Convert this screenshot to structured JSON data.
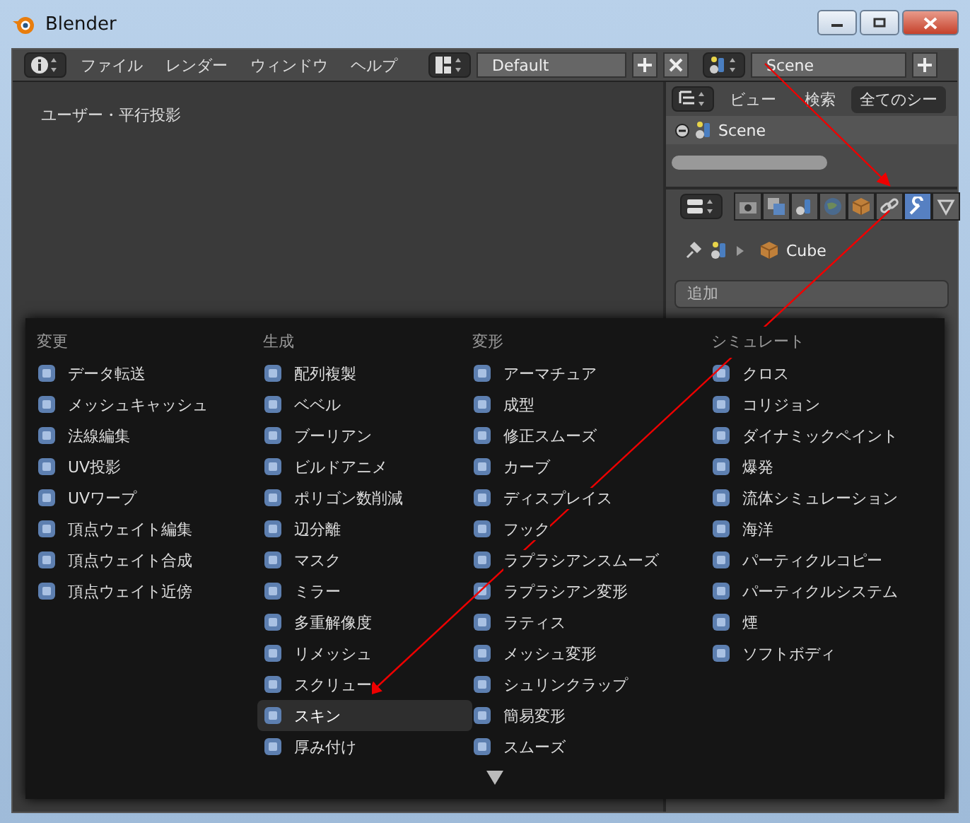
{
  "window": {
    "title": "Blender"
  },
  "top_bar": {
    "menus": [
      "ファイル",
      "レンダー",
      "ウィンドウ",
      "ヘルプ"
    ],
    "layout": "Default",
    "scene": "Scene"
  },
  "viewport": {
    "label": "ユーザー・平行投影"
  },
  "outliner": {
    "menus": [
      "ビュー",
      "検索"
    ],
    "filter": "全てのシー",
    "rows": [
      {
        "label": "Scene",
        "expanded": true
      }
    ]
  },
  "properties": {
    "tabs": [
      {
        "kind": "render",
        "selected": false
      },
      {
        "kind": "layers",
        "selected": false
      },
      {
        "kind": "scene",
        "selected": false
      },
      {
        "kind": "world",
        "selected": false
      },
      {
        "kind": "object",
        "selected": false
      },
      {
        "kind": "constraints",
        "selected": false
      },
      {
        "kind": "modifiers",
        "selected": true
      },
      {
        "kind": "data",
        "selected": false
      }
    ],
    "breadcrumb": "Cube",
    "add_button": "追加"
  },
  "add_modifier_menu": {
    "columns": [
      {
        "heading": "変更",
        "items": [
          {
            "label": "データ転送",
            "selected": false
          },
          {
            "label": "メッシュキャッシュ",
            "selected": false
          },
          {
            "label": "法線編集",
            "selected": false
          },
          {
            "label": "UV投影",
            "selected": false
          },
          {
            "label": "UVワープ",
            "selected": false
          },
          {
            "label": "頂点ウェイト編集",
            "selected": false
          },
          {
            "label": "頂点ウェイト合成",
            "selected": false
          },
          {
            "label": "頂点ウェイト近傍",
            "selected": false
          }
        ]
      },
      {
        "heading": "生成",
        "items": [
          {
            "label": "配列複製",
            "selected": false
          },
          {
            "label": "ベベル",
            "selected": false
          },
          {
            "label": "ブーリアン",
            "selected": false
          },
          {
            "label": "ビルドアニメ",
            "selected": false
          },
          {
            "label": "ポリゴン数削減",
            "selected": false
          },
          {
            "label": "辺分離",
            "selected": false
          },
          {
            "label": "マスク",
            "selected": false
          },
          {
            "label": "ミラー",
            "selected": false
          },
          {
            "label": "多重解像度",
            "selected": false
          },
          {
            "label": "リメッシュ",
            "selected": false
          },
          {
            "label": "スクリュー",
            "selected": false
          },
          {
            "label": "スキン",
            "selected": true
          },
          {
            "label": "厚み付け",
            "selected": false
          }
        ]
      },
      {
        "heading": "変形",
        "items": [
          {
            "label": "アーマチュア",
            "selected": false
          },
          {
            "label": "成型",
            "selected": false
          },
          {
            "label": "修正スムーズ",
            "selected": false
          },
          {
            "label": "カーブ",
            "selected": false
          },
          {
            "label": "ディスプレイス",
            "selected": false
          },
          {
            "label": "フック",
            "selected": false
          },
          {
            "label": "ラプラシアンスムーズ",
            "selected": false
          },
          {
            "label": "ラプラシアン変形",
            "selected": false
          },
          {
            "label": "ラティス",
            "selected": false
          },
          {
            "label": "メッシュ変形",
            "selected": false
          },
          {
            "label": "シュリンクラップ",
            "selected": false
          },
          {
            "label": "簡易変形",
            "selected": false
          },
          {
            "label": "スムーズ",
            "selected": false
          }
        ]
      },
      {
        "heading": "シミュレート",
        "items": [
          {
            "label": "クロス",
            "selected": false
          },
          {
            "label": "コリジョン",
            "selected": false
          },
          {
            "label": "ダイナミックペイント",
            "selected": false
          },
          {
            "label": "爆発",
            "selected": false
          },
          {
            "label": "流体シミュレーション",
            "selected": false
          },
          {
            "label": "海洋",
            "selected": false
          },
          {
            "label": "パーティクルコピー",
            "selected": false
          },
          {
            "label": "パーティクルシステム",
            "selected": false
          },
          {
            "label": "煙",
            "selected": false
          },
          {
            "label": "ソフトボディ",
            "selected": false
          }
        ]
      }
    ]
  }
}
